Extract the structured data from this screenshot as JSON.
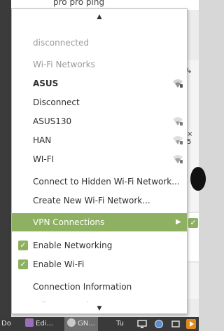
{
  "background": {
    "top_text": "pro pro ping",
    "right_text": "× 5",
    "right_arrow": "↳"
  },
  "menu": {
    "scroll_up_icon": "▲",
    "scroll_down_icon": "▼",
    "status": "disconnected",
    "wifi_header": "Wi-Fi Networks",
    "active_network": "ASUS",
    "disconnect": "Disconnect",
    "networks": [
      "ASUS130",
      "HAN",
      "WI-FI"
    ],
    "connect_hidden": "Connect to Hidden Wi-Fi Network...",
    "create_new": "Create New Wi-Fi Network...",
    "vpn": "VPN Connections",
    "vpn_arrow": "▶",
    "enable_networking": "Enable Networking",
    "enable_wifi": "Enable Wi-Fi",
    "connection_info": "Connection Information",
    "edit_connections": "Edit Connections...",
    "check_glyph": "✓"
  },
  "taskbar": {
    "tasks": [
      "Do",
      "Edi...",
      "GN..."
    ],
    "extra": "Tu"
  },
  "colors": {
    "accent": "#8eb161",
    "menu_bg": "#ffffff",
    "taskbar_bg": "#3a3a3a"
  }
}
